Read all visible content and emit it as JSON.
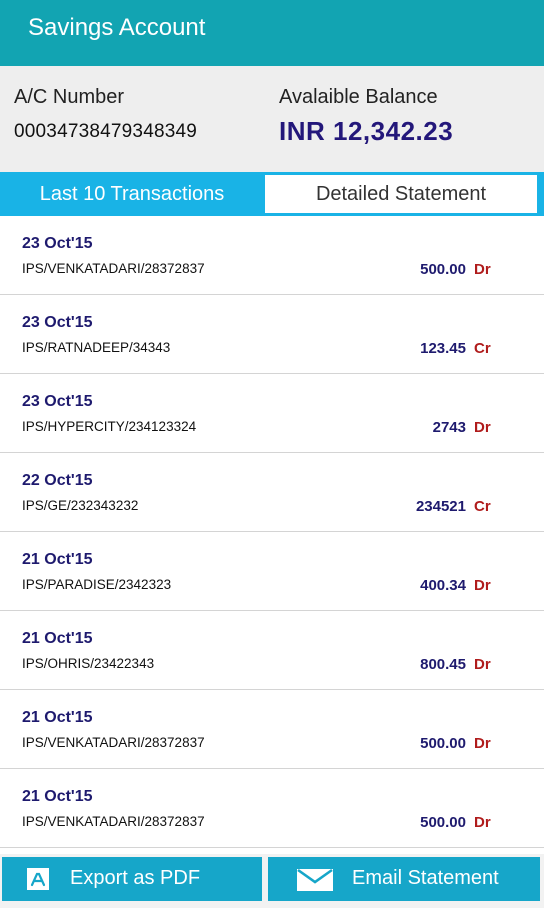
{
  "header": {
    "title": "Savings Account"
  },
  "account": {
    "number_label": "A/C Number",
    "number": "00034738479348349",
    "balance_label": "Avalaible Balance",
    "balance": "INR 12,342.23"
  },
  "tabs": [
    {
      "label": "Last 10 Transactions",
      "active": true
    },
    {
      "label": "Detailed Statement",
      "active": false
    }
  ],
  "transactions": [
    {
      "date": "23 Oct'15",
      "desc": "IPS/VENKATADARI/28372837",
      "amount": "500.00",
      "type": "Dr"
    },
    {
      "date": "23 Oct'15",
      "desc": "IPS/RATNADEEP/34343",
      "amount": "123.45",
      "type": "Cr"
    },
    {
      "date": "23 Oct'15",
      "desc": "IPS/HYPERCITY/234123324",
      "amount": "2743",
      "type": "Dr"
    },
    {
      "date": "22 Oct'15",
      "desc": "IPS/GE/232343232",
      "amount": "234521",
      "type": "Cr"
    },
    {
      "date": "21 Oct'15",
      "desc": "IPS/PARADISE/2342323",
      "amount": "400.34",
      "type": "Dr"
    },
    {
      "date": "21 Oct'15",
      "desc": "IPS/OHRIS/23422343",
      "amount": "800.45",
      "type": "Dr"
    },
    {
      "date": "21 Oct'15",
      "desc": "IPS/VENKATADARI/28372837",
      "amount": "500.00",
      "type": "Dr"
    },
    {
      "date": "21 Oct'15",
      "desc": "IPS/VENKATADARI/28372837",
      "amount": "500.00",
      "type": "Dr"
    }
  ],
  "footer": {
    "export_label": "Export as PDF",
    "export_icon": "pdf-icon",
    "email_label": "Email Statement",
    "email_icon": "envelope-icon"
  },
  "colors": {
    "header": "#12a4b2",
    "tab_active": "#19b3e6",
    "balance": "#23177a",
    "debit_credit": "#b01c1c",
    "footer_button": "#16a6c9"
  }
}
